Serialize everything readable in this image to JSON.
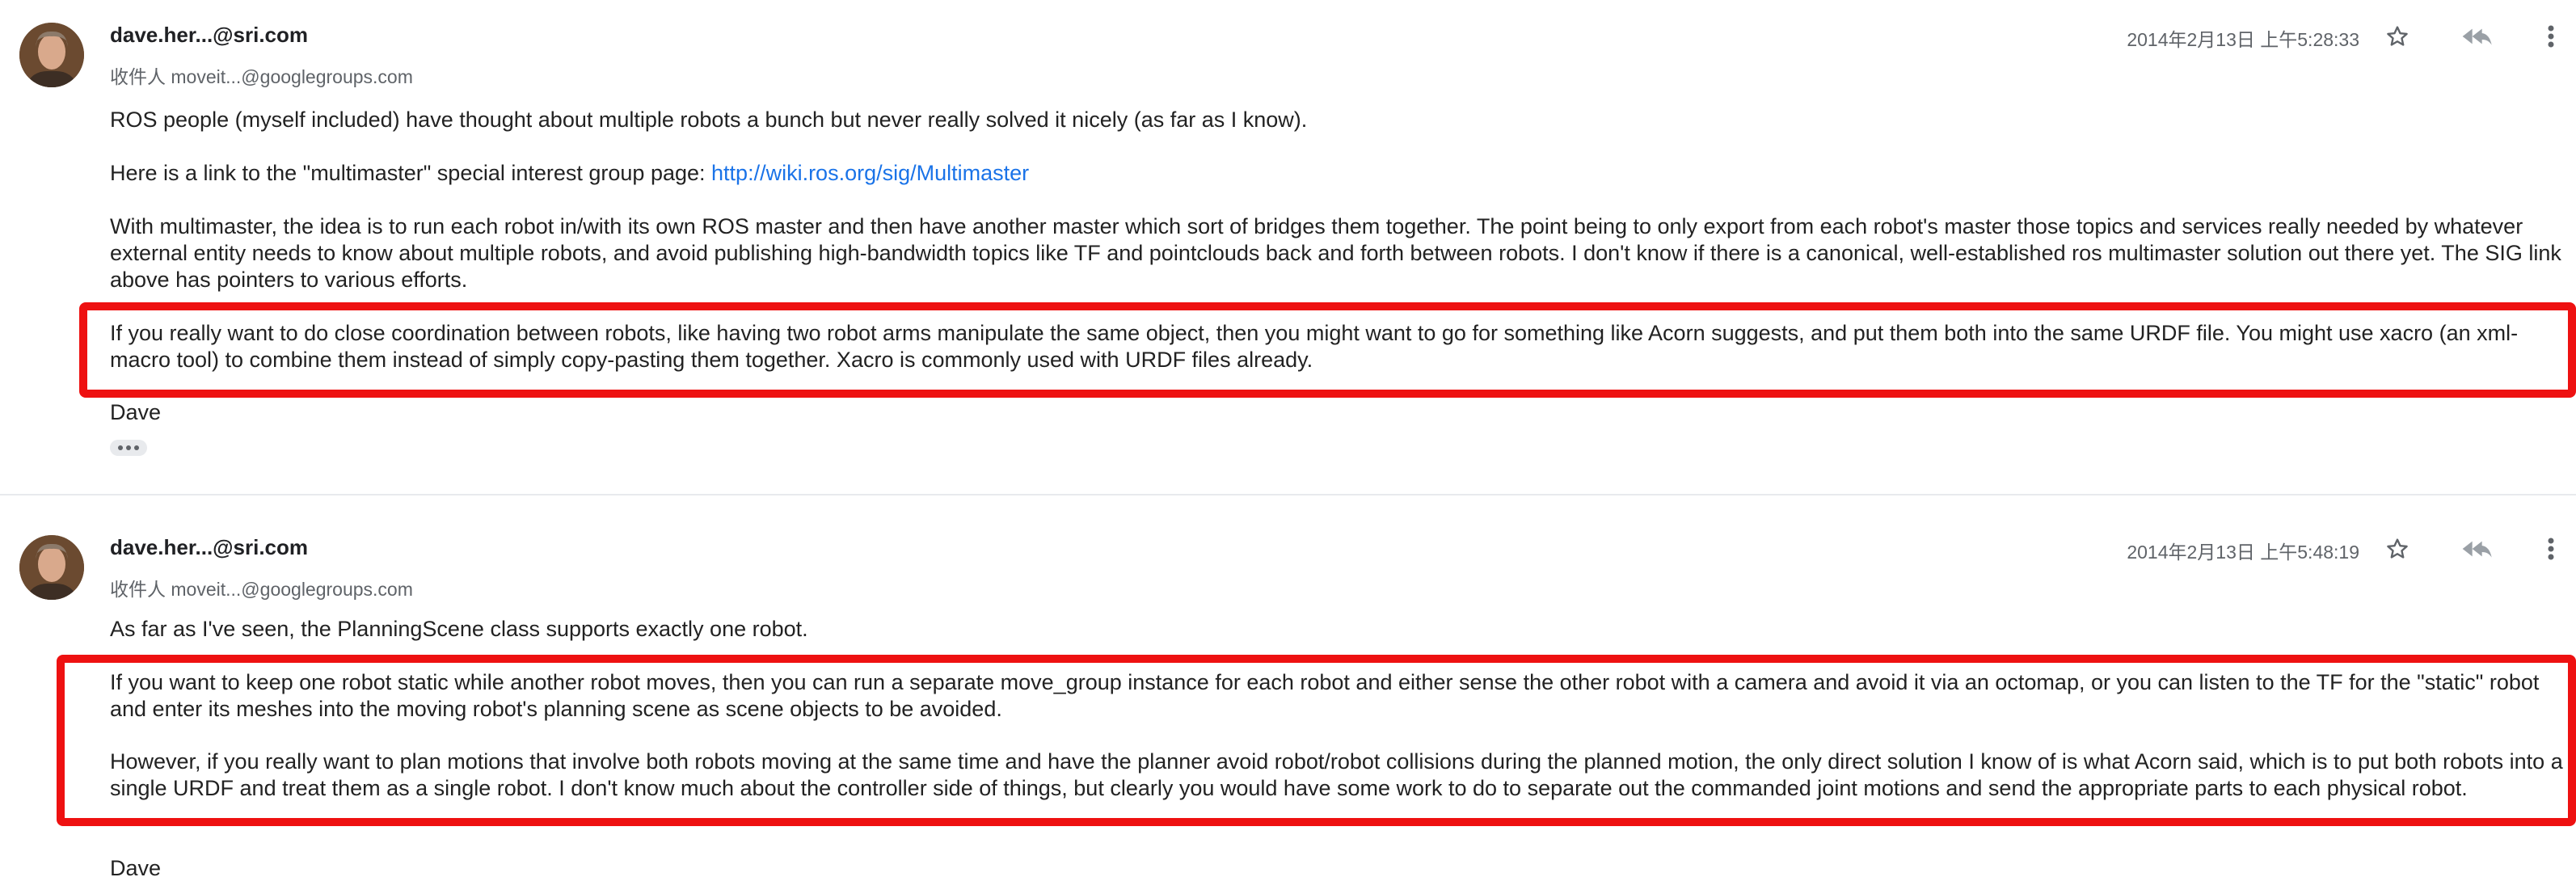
{
  "messages": [
    {
      "sender": "dave.her...@sri.com",
      "recipients": "收件人 moveit...@googlegroups.com",
      "date": "2014年2月13日 上午5:28:33",
      "paragraphs": {
        "p1": "ROS people (myself included) have thought about multiple robots a bunch but never really solved it nicely (as far as I know).",
        "p2_prefix": "Here is a link to the \"multimaster\" special interest group page: ",
        "p2_link": "http://wiki.ros.org/sig/Multimaster",
        "p3": "With multimaster, the idea is to run each robot in/with its own ROS master and then have another master which sort of bridges them together.  The point being to only export from each robot's master those topics and services really needed by whatever external entity needs to know about multiple robots, and avoid publishing high-bandwidth topics like TF and pointclouds back and forth between robots.  I don't know if there is a canonical, well-established ros multimaster solution out there yet.  The SIG link above has pointers to various efforts.",
        "p4": "If you really want to do close coordination between robots, like having two robot arms manipulate the same object, then you might want to go for something like Acorn suggests, and put them both into the same URDF file.  You might use xacro (an xml-macro tool) to combine them instead of simply copy-pasting them together.  Xacro is commonly used with URDF files already.",
        "signature": "Dave"
      }
    },
    {
      "sender": "dave.her...@sri.com",
      "recipients": "收件人 moveit...@googlegroups.com",
      "date": "2014年2月13日 上午5:48:19",
      "paragraphs": {
        "p1": "As far as I've seen, the PlanningScene class supports exactly one robot.",
        "p2": "If you want to keep one robot static while another robot moves, then you can run a separate move_group instance for each robot and either sense the other robot with a camera and avoid it via an octomap, or you can listen to the TF for the \"static\" robot and enter its meshes into the moving robot's planning scene as scene objects to be avoided.",
        "p3": "However, if you really want to plan motions that involve both robots moving at the same time and have the planner avoid robot/robot collisions during the planned motion, the only direct solution I know of is what Acorn said, which is to put both robots into a single URDF and treat them as a single robot.  I don't know much about the controller side of things, but clearly you would have some work to do to separate out the commanded joint motions and send the appropriate parts to each physical robot.",
        "signature": "Dave"
      }
    }
  ],
  "icons": {
    "star": "star-icon",
    "reply_all": "reply-all-icon",
    "more": "more-vert-icon",
    "expand": "ellipsis-icon"
  },
  "colors": {
    "highlight": "#ee1111",
    "link": "#1a73e8",
    "secondary_text": "#5f6368"
  }
}
